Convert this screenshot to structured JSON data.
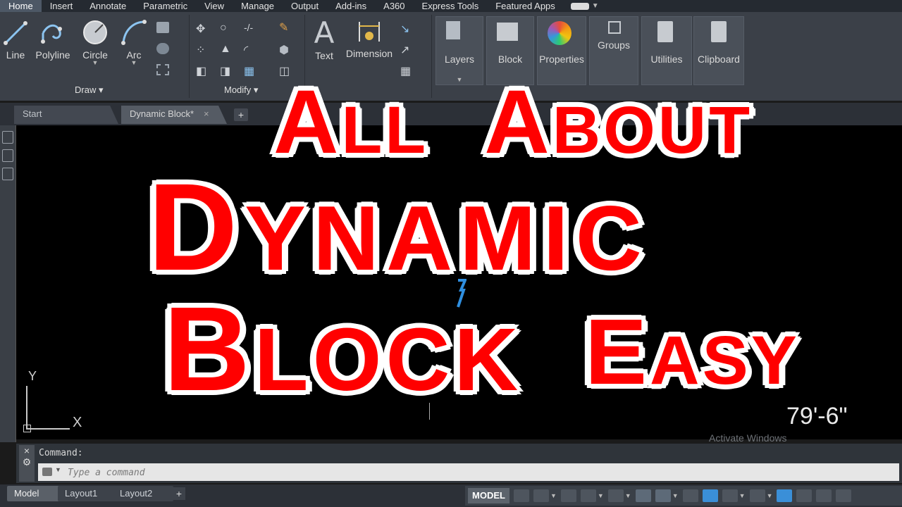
{
  "ribbon_tabs": [
    "Home",
    "Insert",
    "Annotate",
    "Parametric",
    "View",
    "Manage",
    "Output",
    "Add-ins",
    "A360",
    "Express Tools",
    "Featured Apps"
  ],
  "draw_tools": [
    "Line",
    "Polyline",
    "Circle",
    "Arc"
  ],
  "annotation_tools": [
    "Text",
    "Dimension"
  ],
  "big_panels": [
    "Layers",
    "Block",
    "Properties",
    "Groups",
    "Utilities",
    "Clipboard"
  ],
  "panel_titles": {
    "draw": "Draw",
    "modify": "Modify"
  },
  "file_tabs": {
    "start": "Start",
    "doc": "Dynamic Block*",
    "close": "×",
    "add": "+"
  },
  "canvas": {
    "ucs_y": "Y",
    "ucs_x": "X",
    "dimension_value": "79'-6\"",
    "watermark": "Activate Windows"
  },
  "command": {
    "history": "Command:",
    "placeholder": "Type a command",
    "close": "×"
  },
  "layout_tabs": [
    "Model",
    "Layout1",
    "Layout2"
  ],
  "layout_add": "+",
  "status": {
    "model": "MODEL"
  },
  "overlay": {
    "line1_a_cap": "A",
    "line1_a_rest": "LL",
    "line1_b_cap": "A",
    "line1_b_rest": "BOUT",
    "line2_cap": "D",
    "line2_rest": "YNAMIC",
    "line3_cap": "B",
    "line3_rest": "LOCK",
    "line4_cap": "E",
    "line4_rest": "ASY"
  },
  "colors": {
    "overlay_text": "#ff0000",
    "overlay_outline": "#ffffff",
    "canvas": "#000000",
    "ribbon": "#3b4048"
  }
}
